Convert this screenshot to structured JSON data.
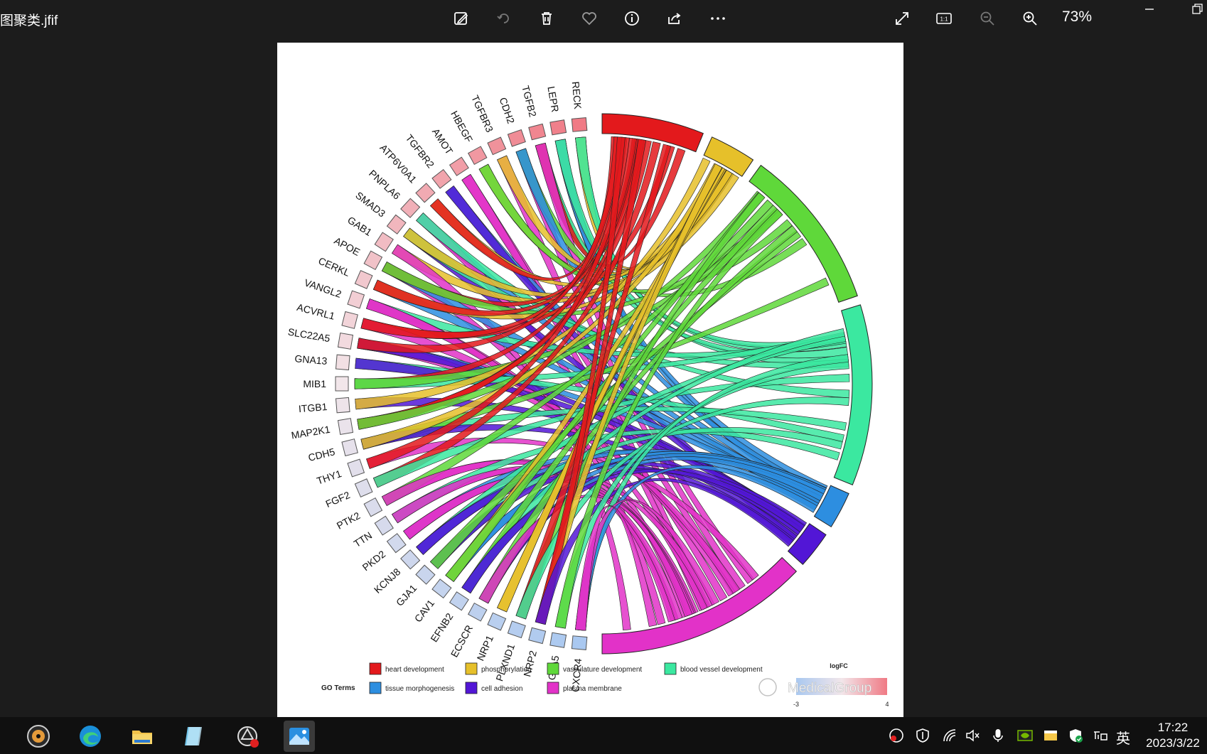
{
  "window": {
    "filename": "图聚类.jfif",
    "zoom_label": "73%"
  },
  "toolbar": {
    "icons": [
      "edit-image-icon",
      "rotate-icon",
      "delete-icon",
      "favorite-icon",
      "info-icon",
      "share-icon",
      "more-icon",
      "fullscreen-icon",
      "actual-size-icon",
      "zoom-out-icon",
      "zoom-in-icon"
    ],
    "actual_size_label": "1:1"
  },
  "chart": {
    "genes": [
      "RECK",
      "LEPR",
      "TGFB2",
      "CDH2",
      "TGFBR3",
      "HBEGF",
      "AMOT",
      "TGFBR2",
      "ATP6V0A1",
      "PNPLA6",
      "SMAD3",
      "GAB1",
      "APOE",
      "CERKL",
      "VANGL2",
      "ACVRL1",
      "SLC22A5",
      "GNA13",
      "MIB1",
      "ITGB1",
      "MAP2K1",
      "CDH5",
      "THY1",
      "FGF2",
      "PTK2",
      "TTN",
      "PKD2",
      "KCNJ8",
      "GJA1",
      "CAV1",
      "EFNB2",
      "ECSCR",
      "NRP1",
      "PLXND1",
      "NRP2",
      "GJA5",
      "CXCR4"
    ],
    "terms": [
      {
        "name": "heart development",
        "color": "#e3191c"
      },
      {
        "name": "phosphorylation",
        "color": "#e6c02a"
      },
      {
        "name": "vasculature development",
        "color": "#5fd83a"
      },
      {
        "name": "blood vessel development",
        "color": "#3be8a0"
      },
      {
        "name": "tissue morphogenesis",
        "color": "#2d8ee0"
      },
      {
        "name": "cell adhesion",
        "color": "#5216d6"
      },
      {
        "name": "plasma membrane",
        "color": "#e232c8"
      }
    ],
    "legend_title": "GO Terms",
    "logfc_title": "logFC",
    "logfc_min": "-3",
    "logfc_max": "4",
    "logfc_colors": [
      "#a9c8f0",
      "#f2e6ea",
      "#f07a85"
    ],
    "watermark": "MedicalGroup"
  },
  "taskbar": {
    "apps": [
      "disc-app-icon",
      "edge-browser-icon",
      "file-explorer-icon",
      "notepad-icon",
      "screen-recorder-icon",
      "photos-app-icon"
    ],
    "tray": [
      "record-tray-icon",
      "security-tray-icon",
      "wifi-tray-icon",
      "volume-muted-icon",
      "microphone-icon",
      "nvidia-icon",
      "window-tray-icon",
      "defender-icon",
      "input-switch-icon"
    ],
    "ime_label": "英",
    "time": "17:22",
    "date": "2023/3/22"
  }
}
